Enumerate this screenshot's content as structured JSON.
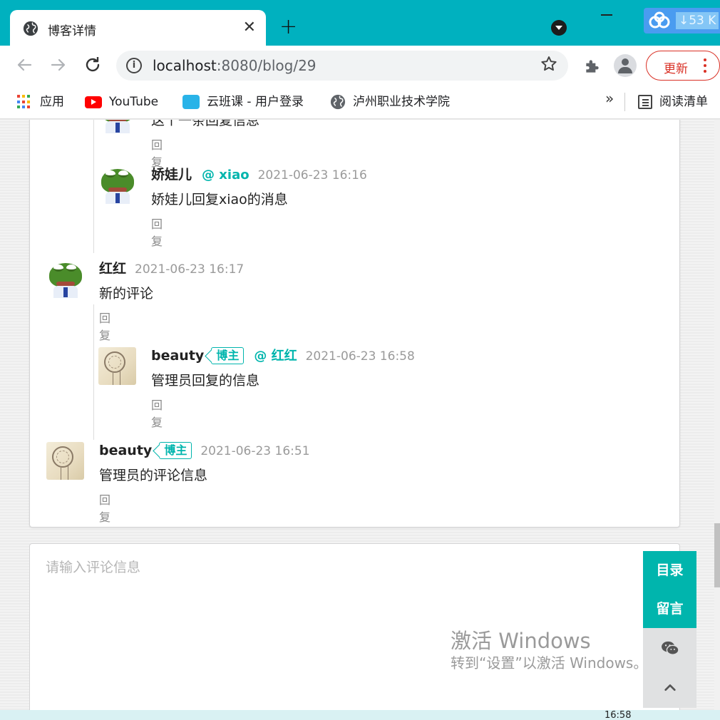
{
  "browser": {
    "tab_title": "博客详情",
    "tab_close": "✕",
    "new_tab": "+",
    "net_speed": "↓53 K",
    "url_host": "localhost",
    "url_path": ":8080/blog/29",
    "update_label": "更新",
    "icons": {
      "back": "arrow-left-icon",
      "forward": "arrow-right-icon",
      "reload": "reload-icon",
      "star": "star-icon",
      "extensions": "puzzle-icon",
      "profile": "person-icon"
    }
  },
  "bookmarks": {
    "apps": "应用",
    "youtube": "YouTube",
    "yunbanke": "云班课 - 用户登录",
    "luzhou": "泸州职业技术学院",
    "more": "»",
    "reading_list": "阅读清单"
  },
  "comments": {
    "reply_label": "回复",
    "items": [
      {
        "author": "",
        "text": "这个一条回复信息",
        "time": ""
      },
      {
        "author": "娇娃儿",
        "mention": "@ xiao",
        "time": "2021-06-23 16:16",
        "text": "娇娃儿回复xiao的消息"
      },
      {
        "author": "红红",
        "time": "2021-06-23 16:17",
        "text": "新的评论"
      },
      {
        "author": "beauty",
        "badge": "博主",
        "mention": "@ 红红",
        "time": "2021-06-23 16:58",
        "text": "管理员回复的信息"
      },
      {
        "author": "beauty",
        "badge": "博主",
        "time": "2021-06-23 16:51",
        "text": "管理员的评论信息"
      }
    ]
  },
  "comment_form": {
    "placeholder": "请输入评论信息"
  },
  "side_tools": {
    "toc": "目录",
    "message": "留言",
    "wechat_icon": "wechat-icon",
    "top_icon": "chevron-up-icon"
  },
  "windows_watermark": {
    "line1": "激活 Windows",
    "line2": "转到“设置”以激活 Windows。"
  },
  "taskbar": {
    "clock": "16:58"
  },
  "colors": {
    "browser_accent": "#00b1bf",
    "teal": "#00b5ad",
    "update_red": "#d93025"
  }
}
